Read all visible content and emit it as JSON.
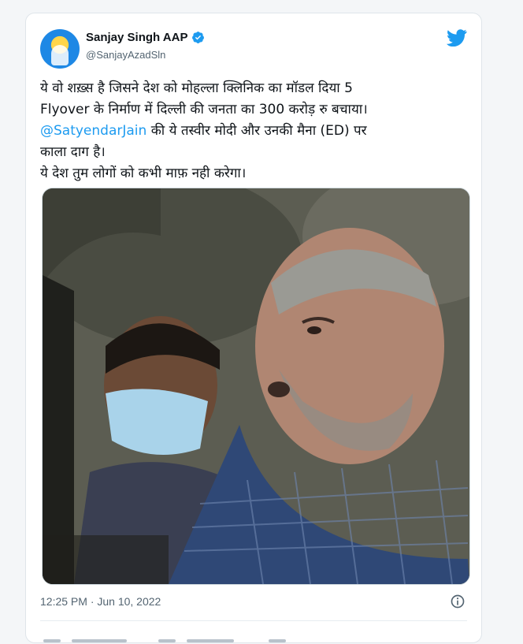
{
  "tweet": {
    "author": {
      "display_name": "Sanjay Singh AAP",
      "handle": "@SanjayAzadSln",
      "verified": true
    },
    "text_lines": [
      "ये वो शख़्स है जिसने देश को मोहल्ला क्लिनिक का मॉडल दिया 5",
      "Flyover के निर्माण में दिल्ली की जनता का 300 करोड़ रु बचाया।",
      "की ये तस्वीर मोदी और उनकी मैना (ED) पर",
      "काला दाग है।",
      "ये देश तुम लोगों को कभी माफ़ नही करेगा।"
    ],
    "mention": "@SatyendarJain",
    "timestamp": "12:25 PM · Jun 10, 2022"
  },
  "icons": {
    "verified": "verified-badge-icon",
    "brand": "twitter-bird-icon",
    "info": "info-icon"
  },
  "colors": {
    "mention_blue": "#1d9bf0",
    "text": "#0f1419",
    "secondary": "#536471"
  }
}
